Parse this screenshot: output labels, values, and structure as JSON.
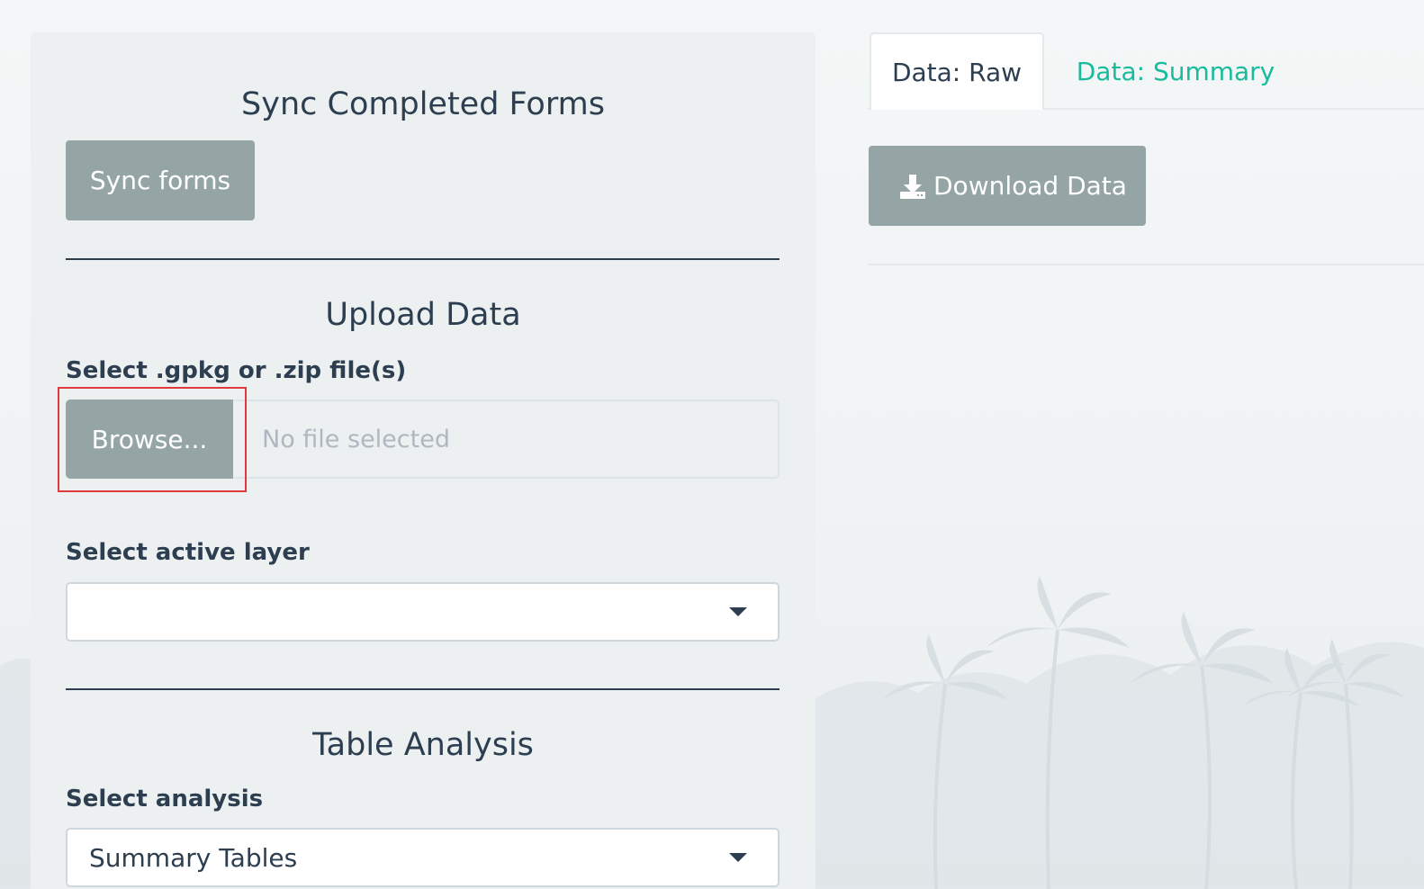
{
  "sidebar": {
    "sync": {
      "title": "Sync Completed Forms",
      "button_label": "Sync forms"
    },
    "upload": {
      "title": "Upload Data",
      "file_label": "Select .gpkg or .zip file(s)",
      "browse_label": "Browse...",
      "file_placeholder": "No file selected"
    },
    "layer": {
      "label": "Select active layer",
      "selected_value": ""
    },
    "analysis": {
      "title": "Table Analysis",
      "label": "Select analysis",
      "selected_value": "Summary Tables"
    }
  },
  "main": {
    "tabs": [
      {
        "label": "Data: Raw",
        "active": true
      },
      {
        "label": "Data: Summary",
        "active": false
      }
    ],
    "download_label": "Download Data"
  },
  "colors": {
    "button_bg": "#95a5a6",
    "text": "#2c3e50",
    "link": "#18bc9c",
    "panel_bg": "#ecf0f1",
    "highlight": "#e03a3a"
  },
  "icons": {
    "download": "download-icon",
    "dropdown": "chevron-down-icon"
  }
}
